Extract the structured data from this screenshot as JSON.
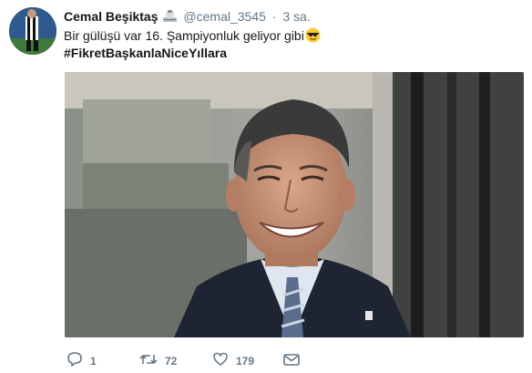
{
  "tweet": {
    "display_name": "Cemal Beşiktaş",
    "handle": "@cemal_3545",
    "separator": "·",
    "time": "3 sa.",
    "text": "Bir gülüşü var 16. Şampiyonluk geliyor gibi",
    "hashtag": "#FikretBaşkanlaNiceYıllara"
  },
  "actions": {
    "replies": "1",
    "retweets": "72",
    "likes": "179"
  },
  "icons": [
    "avatar",
    "badge-icon",
    "sunglasses-emoji-icon",
    "reply-icon",
    "retweet-icon",
    "like-icon",
    "direct-message-icon"
  ],
  "colors": {
    "text": "#14171a",
    "secondary": "#657786"
  }
}
